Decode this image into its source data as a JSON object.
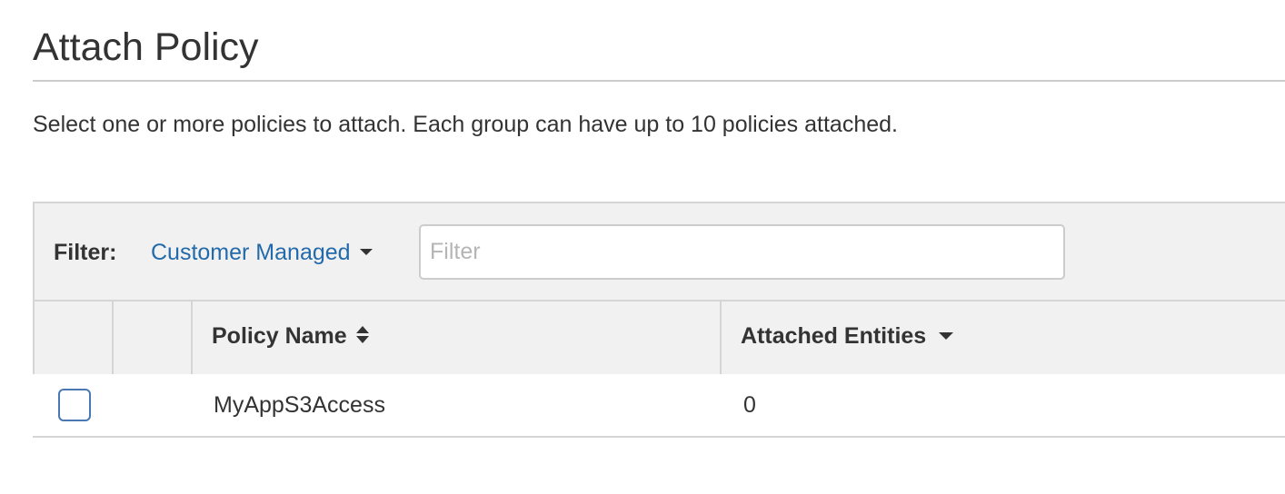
{
  "page": {
    "title": "Attach Policy",
    "description": "Select one or more policies to attach. Each group can have up to 10 policies attached."
  },
  "filter": {
    "label": "Filter:",
    "dropdown_value": "Customer Managed",
    "input_placeholder": "Filter",
    "input_value": ""
  },
  "table": {
    "columns": [
      {
        "label": "Policy Name",
        "sort": "sortable"
      },
      {
        "label": "Attached Entities",
        "sort": "descending"
      }
    ],
    "rows": [
      {
        "checked": false,
        "policy_name": "MyAppS3Access",
        "attached_entities": "0"
      }
    ]
  },
  "colors": {
    "link": "#236aaa",
    "header_bg": "#f1f1f1",
    "checkbox_border": "#4a78b3"
  },
  "icons": {
    "dropdown_caret": "caret-down-icon",
    "policy_name_sort": "sort-icon",
    "attached_entities_sort": "sort-down-icon"
  }
}
